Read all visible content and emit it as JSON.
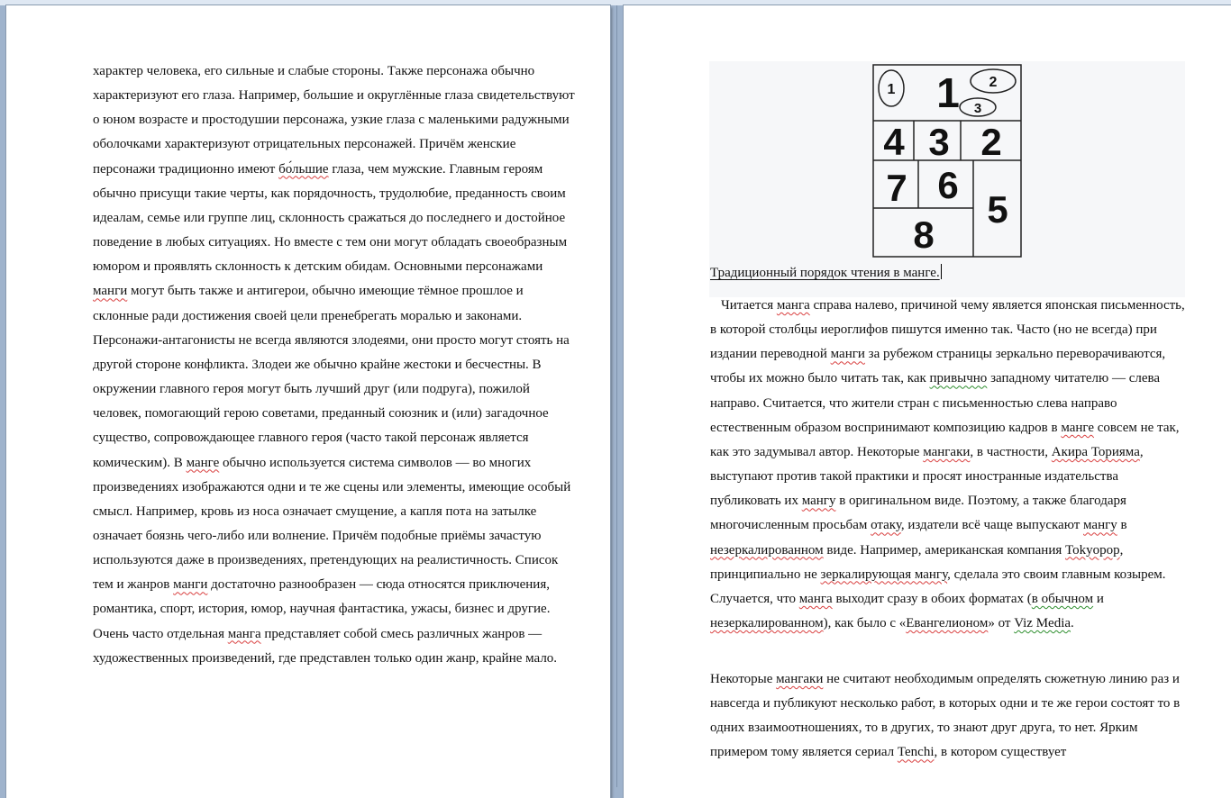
{
  "page1": {
    "paragraph": [
      {
        "t": "характер человека, его сильные и слабые стороны. Также персонажа обычно характеризуют его глаза. Например, большие и округлённые глаза свидетельствуют о юном возрасте и простодушии персонажа, узкие глаза с маленькими радужными оболочками характеризуют отрицательных персонажей. Причём женские персонажи традиционно имеют "
      },
      {
        "t": "бо́льшие",
        "m": "sq"
      },
      {
        "t": " глаза, чем мужские. Главным героям обычно присущи такие черты, как порядочность, трудолюбие, преданность своим идеалам, семье или группе лиц, склонность сражаться до последнего и достойное поведение в любых ситуациях. Но вместе с тем они могут обладать своеобразным юмором и проявлять склонность к детским обидам. Основными персонажами "
      },
      {
        "t": "манги",
        "m": "sq"
      },
      {
        "t": " могут быть также и антигерои, обычно имеющие тёмное прошлое и склонные ради достижения своей цели пренебрегать моралью и законами. Персонажи-антагонисты не всегда являются злодеями, они просто могут стоять на другой стороне конфликта. Злодеи же обычно крайне жестоки и бесчестны. В окружении главного героя могут быть лучший друг (или подруга), пожилой человек, помогающий герою советами, преданный союзник и (или) загадочное существо, сопровождающее главного героя (часто такой персонаж является комическим). В "
      },
      {
        "t": "манге",
        "m": "sq"
      },
      {
        "t": " обычно используется система символов — во многих произведениях изображаются одни и те же сцены или элементы, имеющие особый смысл. Например, кровь из носа означает смущение, а капля пота на затылке означает боязнь чего-либо или волнение. Причём подобные приёмы зачастую используются даже в произведениях, претендующих на реалистичность. Список тем и жанров "
      },
      {
        "t": "манги",
        "m": "sq"
      },
      {
        "t": " достаточно разнообразен — сюда относятся приключения, романтика, спорт, история, юмор, научная фантастика, ужасы, бизнес и другие. Очень часто отдельная "
      },
      {
        "t": "манга",
        "m": "sq"
      },
      {
        "t": " представляет собой смесь различных жанров — художественных произведений, где представлен только один жанр, крайне мало."
      }
    ]
  },
  "page2": {
    "diagram": {
      "numbers": [
        "1",
        "1",
        "2",
        "3",
        "4",
        "3",
        "2",
        "7",
        "6",
        "5",
        "8"
      ]
    },
    "caption": "Традиционный порядок чтения в манге.",
    "paragraph_a": [
      {
        "t": "Читается "
      },
      {
        "t": "манга",
        "m": "sq"
      },
      {
        "t": " справа налево, причиной чему является японская письменность, в которой столбцы иероглифов пишутся именно так. Часто (но не всегда) при издании переводной "
      },
      {
        "t": "манги",
        "m": "sq"
      },
      {
        "t": " за рубежом страницы зеркально переворачиваются, чтобы их можно было читать так, как "
      },
      {
        "t": "привычно",
        "m": "sg"
      },
      {
        "t": " западному читателю — слева направо. Считается, что жители стран с письменностью слева направо естественным образом воспринимают композицию кадров в "
      },
      {
        "t": "манге",
        "m": "sq"
      },
      {
        "t": " совсем не так, как это задумывал автор. Некоторые "
      },
      {
        "t": "мангаки",
        "m": "sq"
      },
      {
        "t": ", в частности, "
      },
      {
        "t": "Акира Торияма",
        "m": "sq"
      },
      {
        "t": ", выступают против такой практики и просят иностранные издательства публиковать их "
      },
      {
        "t": "мангу",
        "m": "sq"
      },
      {
        "t": " в оригинальном виде. Поэтому, а также благодаря многочисленным просьбам "
      },
      {
        "t": "отаку",
        "m": "sq"
      },
      {
        "t": ", издатели всё чаще выпускают "
      },
      {
        "t": "мангу",
        "m": "sq"
      },
      {
        "t": " в "
      },
      {
        "t": "незеркалированном",
        "m": "sq"
      },
      {
        "t": " виде. Например, американская компания "
      },
      {
        "t": "Tokyopop",
        "m": "sq"
      },
      {
        "t": ", принципиально не "
      },
      {
        "t": "зеркалирующая мангу",
        "m": "sq"
      },
      {
        "t": ", сделала это своим главным козырем. Случается, что "
      },
      {
        "t": "манга",
        "m": "sq"
      },
      {
        "t": " выходит сразу в обоих форматах ("
      },
      {
        "t": "в обычном",
        "m": "sg"
      },
      {
        "t": " и "
      },
      {
        "t": "незеркалированном",
        "m": "sq"
      },
      {
        "t": "), как было с «"
      },
      {
        "t": "Евангелионом",
        "m": "sq"
      },
      {
        "t": "» от "
      },
      {
        "t": "Viz Media",
        "m": "sg"
      },
      {
        "t": "."
      }
    ],
    "paragraph_b": [
      {
        "t": "Некоторые "
      },
      {
        "t": "мангаки",
        "m": "sq"
      },
      {
        "t": " не считают необходимым определять сюжетную линию раз и навсегда и публикуют несколько работ, в которых одни и те же герои состоят то в одних взаимоотношениях, то в других, то знают друг друга, то нет. Ярким примером тому является сериал "
      },
      {
        "t": "Tenchi",
        "m": "sq"
      },
      {
        "t": ", в котором существует"
      }
    ]
  }
}
